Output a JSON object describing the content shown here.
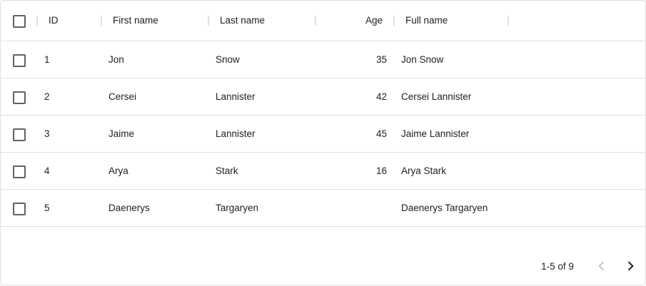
{
  "columns": {
    "id": "ID",
    "first_name": "First name",
    "last_name": "Last name",
    "age": "Age",
    "full_name": "Full name"
  },
  "rows": [
    {
      "id": "1",
      "first_name": "Jon",
      "last_name": "Snow",
      "age": "35",
      "full_name": "Jon Snow"
    },
    {
      "id": "2",
      "first_name": "Cersei",
      "last_name": "Lannister",
      "age": "42",
      "full_name": "Cersei Lannister"
    },
    {
      "id": "3",
      "first_name": "Jaime",
      "last_name": "Lannister",
      "age": "45",
      "full_name": "Jaime Lannister"
    },
    {
      "id": "4",
      "first_name": "Arya",
      "last_name": "Stark",
      "age": "16",
      "full_name": "Arya Stark"
    },
    {
      "id": "5",
      "first_name": "Daenerys",
      "last_name": "Targaryen",
      "age": "",
      "full_name": "Daenerys Targaryen"
    }
  ],
  "pagination": {
    "range_label": "1-5 of 9",
    "prev_icon": "chevron-left-icon",
    "next_icon": "chevron-right-icon",
    "prev_disabled": true
  },
  "colors": {
    "border": "#e0e0e0",
    "text": "#212121",
    "disabled_icon": "#bdbdbd",
    "icon": "#212121"
  }
}
